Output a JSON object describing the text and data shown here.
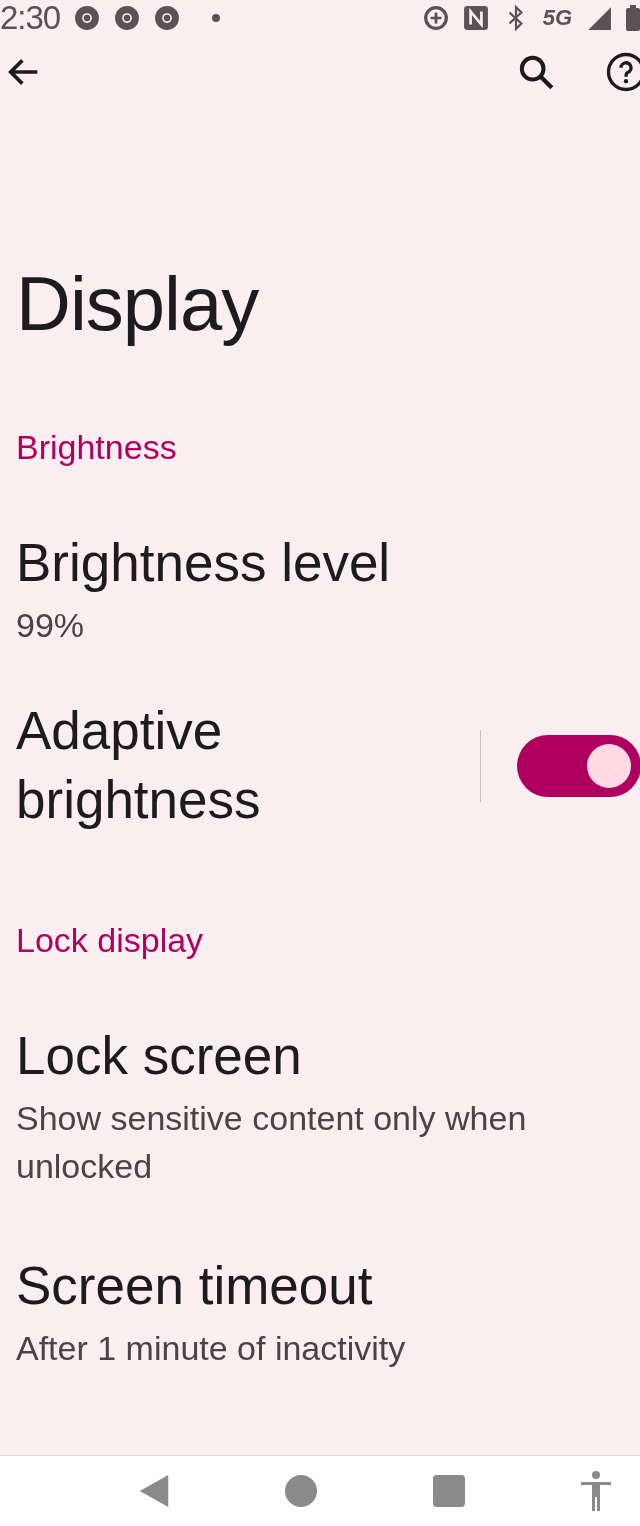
{
  "status_bar": {
    "time": "2:30",
    "network": "5G"
  },
  "toolbar": {
    "title": "Display"
  },
  "sections": [
    {
      "header": "Brightness",
      "items": [
        {
          "kind": "plain",
          "title": "Brightness level",
          "summary": "99%"
        },
        {
          "kind": "switch",
          "title": "Adaptive brightness",
          "on": true
        }
      ]
    },
    {
      "header": "Lock display",
      "items": [
        {
          "kind": "plain",
          "title": "Lock screen",
          "summary": "Show sensitive content only when unlocked"
        },
        {
          "kind": "plain",
          "title": "Screen timeout",
          "summary": "After 1 minute of inactivity"
        }
      ]
    }
  ]
}
